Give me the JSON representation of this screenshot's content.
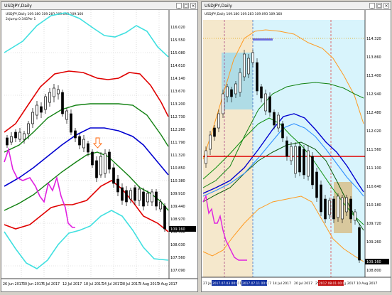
{
  "left_chart": {
    "window_title": "USDJPY,Daily",
    "info_line": "USDJPY,Daily 109.180 109.283 109.093 109.160",
    "indicator_label": "2sJump 0.345Per 1",
    "price_labels": [
      "116.020",
      "115.550",
      "115.080",
      "114.610",
      "114.140",
      "113.670",
      "113.200",
      "112.730",
      "112.260",
      "111.790",
      "111.320",
      "110.850",
      "110.380",
      "109.910",
      "109.440",
      "108.970",
      "108.500",
      "108.030",
      "107.560",
      "107.090"
    ],
    "current_price": "109.160",
    "date_labels": [
      "26 Jun 2017",
      "30 Jun 2017",
      "6 Jul 2017",
      "12 Jul 2017",
      "18 Jul 2017",
      "24 Jul 2017",
      "28 Jul 2017",
      "3 Aug 2017",
      "9 Aug 2017"
    ]
  },
  "right_chart": {
    "window_title": "USDJPY,Daily",
    "info_line": "USDJPY,Daily 109.180 109.283 109.093 109.160",
    "price_labels": [
      "114.320",
      "113.860",
      "113.400",
      "112.940",
      "112.480",
      "112.020",
      "111.560",
      "111.100",
      "110.640",
      "110.180",
      "109.720",
      "109.260",
      "108.800"
    ],
    "current_price": "109.160",
    "date_labels": [
      "27 Jun 2017",
      "4 Jul 2017",
      "11 Jul 2017",
      "14 Jul 2017",
      "20 Jul 2017",
      "25 Jul 2017",
      "2 Aug 2017",
      "10 Aug 2017"
    ],
    "date_tags": [
      "2017.07.03 00:00",
      "2017.07.11 00:00",
      "2017.08.01 00:00"
    ]
  },
  "colors": {
    "cyan": "#40e0e0",
    "red": "#e00000",
    "green": "#108010",
    "blue": "#0000d0",
    "magenta": "#e020e0",
    "orange": "#ff8000",
    "sky": "#d8f4fc"
  }
}
